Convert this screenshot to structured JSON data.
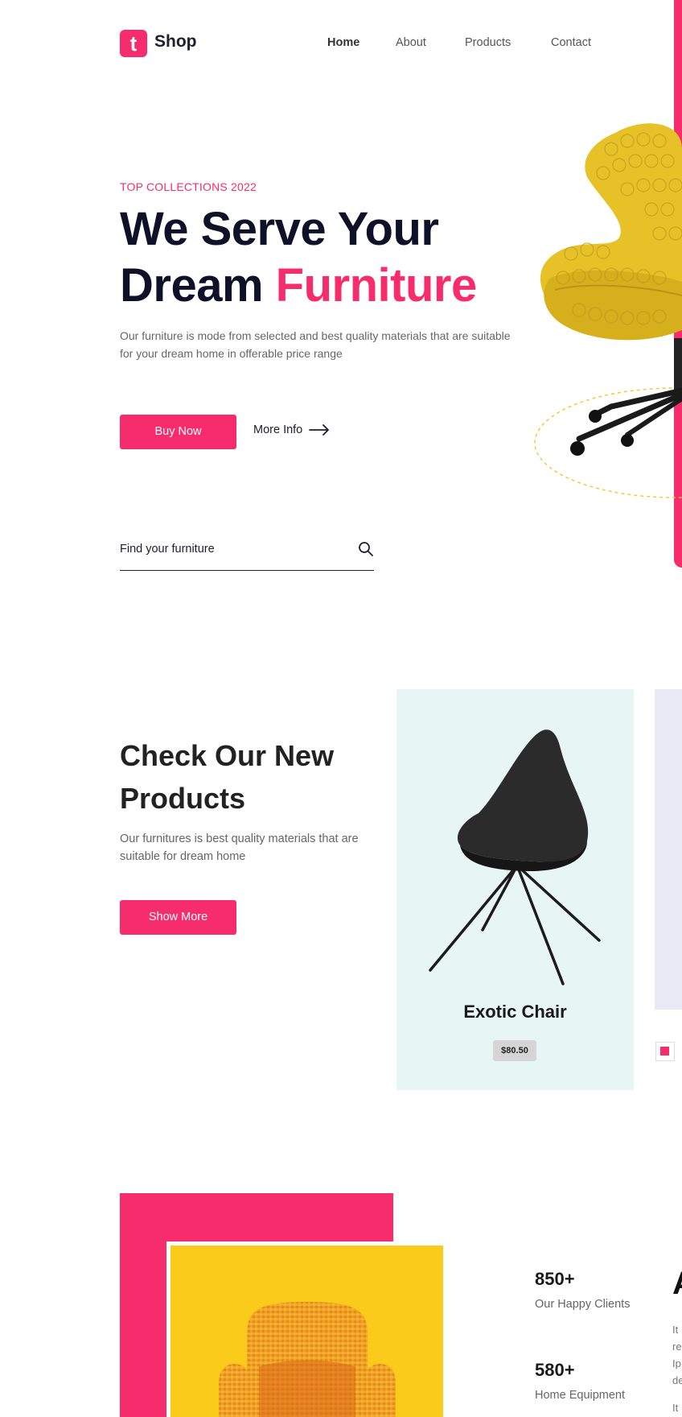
{
  "brand": {
    "logo_letter": "t",
    "name": "Shop"
  },
  "nav": {
    "items": [
      "Home",
      "About",
      "Products",
      "Contact"
    ]
  },
  "hero": {
    "eyebrow": "TOP COLLECTIONS 2022",
    "title_line1": "We Serve Your",
    "title_line2_plain": "Dream ",
    "title_line2_highlight": "Furniture",
    "description": "Our furniture is mode from selected and best quality materials that are suitable for your dream home in offerable price range",
    "buy_label": "Buy Now",
    "more_info_label": "More Info",
    "search_placeholder": "Find your furniture"
  },
  "products": {
    "title": "Check Our New Products",
    "description": "Our furnitures is best quality materials that are suitable for dream home",
    "show_more_label": "Show More",
    "cards": [
      {
        "name": "Exotic Chair",
        "price": "$80.50"
      }
    ]
  },
  "about": {
    "stats": [
      {
        "value": "850+",
        "label": "Our Happy Clients"
      },
      {
        "value": "580+",
        "label": "Home Equipment"
      }
    ],
    "heading_partial": "A",
    "text_partial": [
      "It",
      "re",
      "Ip",
      "de",
      "It"
    ]
  },
  "colors": {
    "accent": "#f72c6c",
    "dark": "#0f1128",
    "mint": "#e8f6f3",
    "yellow": "#facb1b"
  }
}
